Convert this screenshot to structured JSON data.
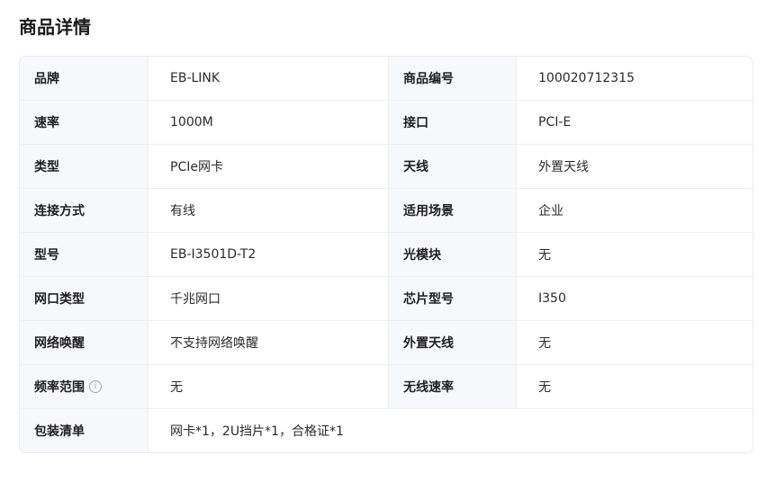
{
  "section": {
    "title": "商品详情"
  },
  "specs": [
    {
      "k1": "品牌",
      "v1": "EB-LINK",
      "k2": "商品编号",
      "v2": "100020712315"
    },
    {
      "k1": "速率",
      "v1": "1000M",
      "k2": "接口",
      "v2": "PCI-E"
    },
    {
      "k1": "类型",
      "v1": "PCIe网卡",
      "k2": "天线",
      "v2": "外置天线"
    },
    {
      "k1": "连接方式",
      "v1": "有线",
      "k2": "适用场景",
      "v2": "企业"
    },
    {
      "k1": "型号",
      "v1": "EB-I3501D-T2",
      "k2": "光模块",
      "v2": "无"
    },
    {
      "k1": "网口类型",
      "v1": "千兆网口",
      "k2": "芯片型号",
      "v2": "I350"
    },
    {
      "k1": "网络唤醒",
      "v1": "不支持网络唤醒",
      "k2": "外置天线",
      "v2": "无"
    },
    {
      "k1": "频率范围",
      "v1": "无",
      "k2": "无线速率",
      "v2": "无"
    }
  ],
  "package": {
    "label": "包装清单",
    "value": "网卡*1，2U挡片*1，合格证*1"
  },
  "icons": {
    "frequency_info": "info-circle-icon",
    "info_glyph": "i"
  }
}
